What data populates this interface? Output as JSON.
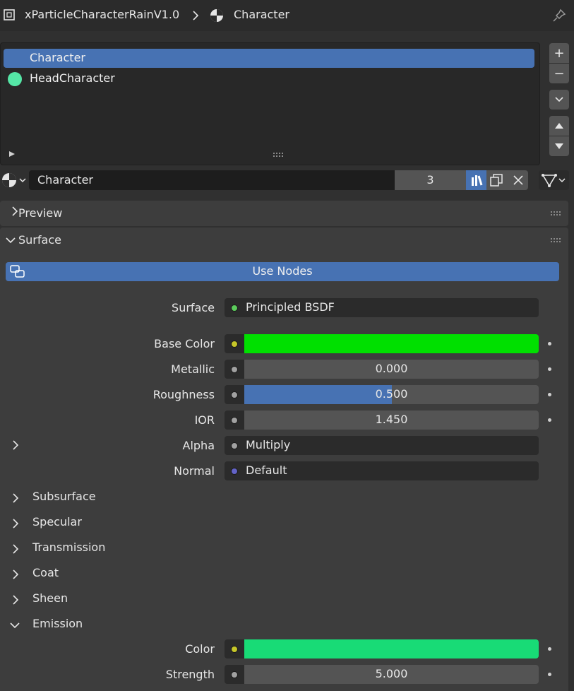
{
  "header": {
    "object_name": "xParticleCharacterRainV1.0",
    "material_name": "Character",
    "icons": [
      "object-icon",
      "chevron-right-icon",
      "material-icon",
      "pin-icon"
    ]
  },
  "slots": {
    "items": [
      {
        "label": "Character",
        "active": true,
        "color": ""
      },
      {
        "label": "HeadCharacter",
        "active": false,
        "color": "#55e6a6"
      }
    ],
    "buttons": [
      "+",
      "−"
    ]
  },
  "id_row": {
    "material_name": "Character",
    "users": "3"
  },
  "panels": {
    "preview": "Preview",
    "surface": "Surface"
  },
  "use_nodes": "Use Nodes",
  "props": {
    "surface": {
      "label": "Surface",
      "value": "Principled BSDF",
      "socket": "#5ccc5c"
    },
    "base_color": {
      "label": "Base Color",
      "color": "#00e000",
      "socket": "#c7c729"
    },
    "metallic": {
      "label": "Metallic",
      "value": "0.000",
      "fraction": 0.0,
      "socket": "#a1a1a1"
    },
    "roughness": {
      "label": "Roughness",
      "value": "0.500",
      "fraction": 0.5,
      "socket": "#a1a1a1"
    },
    "ior": {
      "label": "IOR",
      "value": "1.450",
      "socket": "#a1a1a1"
    },
    "alpha": {
      "label": "Alpha",
      "value": "Multiply",
      "socket": "#a1a1a1"
    },
    "normal": {
      "label": "Normal",
      "value": "Default",
      "socket": "#6363c7"
    }
  },
  "subpanels": [
    {
      "label": "Subsurface",
      "open": false
    },
    {
      "label": "Specular",
      "open": false
    },
    {
      "label": "Transmission",
      "open": false
    },
    {
      "label": "Coat",
      "open": false
    },
    {
      "label": "Sheen",
      "open": false
    },
    {
      "label": "Emission",
      "open": true
    }
  ],
  "emission": {
    "color": {
      "label": "Color",
      "color": "#18db76",
      "socket": "#c7c729"
    },
    "strength": {
      "label": "Strength",
      "value": "5.000",
      "socket": "#a1a1a1"
    }
  }
}
